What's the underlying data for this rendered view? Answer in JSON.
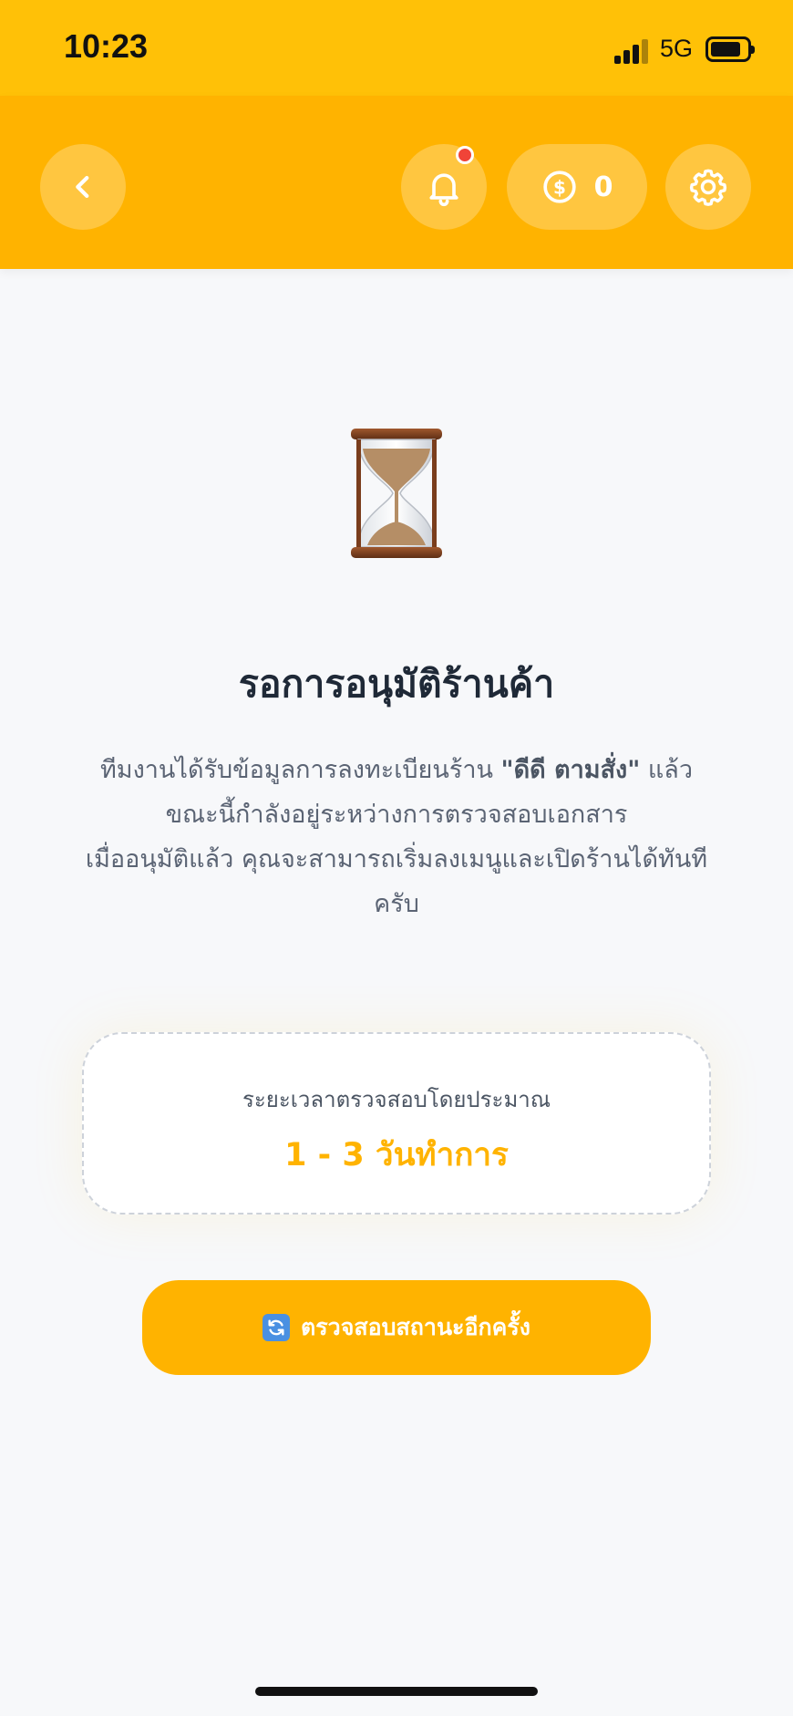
{
  "status_bar": {
    "time": "10:23",
    "network": "5G"
  },
  "header": {
    "coin_count": "0",
    "notification_dot_color": "#f04438"
  },
  "main": {
    "title": "รอการอนุมัติร้านค้า",
    "description": {
      "line1_prefix": "ทีมงานได้รับข้อมูลการลงทะเบียนร้าน ",
      "shop_name": "\"ดีดี ตามสั่ง\"",
      "line1_suffix": " แล้ว",
      "line2": "ขณะนี้กำลังอยู่ระหว่างการตรวจสอบเอกสาร",
      "line3": "เมื่ออนุมัติแล้ว คุณจะสามารถเริ่มลงเมนูและเปิดร้านได้ทันทีครับ"
    },
    "estimate_card": {
      "label": "ระยะเวลาตรวจสอบโดยประมาณ",
      "value": "1 - 3 วันทำการ"
    },
    "check_status_button": {
      "label": "ตรวจสอบสถานะอีกครั้ง"
    }
  },
  "colors": {
    "status_bar": "#ffc107",
    "header": "#ffb300",
    "accent": "#ffb300",
    "text_dark": "#1f2937",
    "text_muted": "#5b6474"
  }
}
